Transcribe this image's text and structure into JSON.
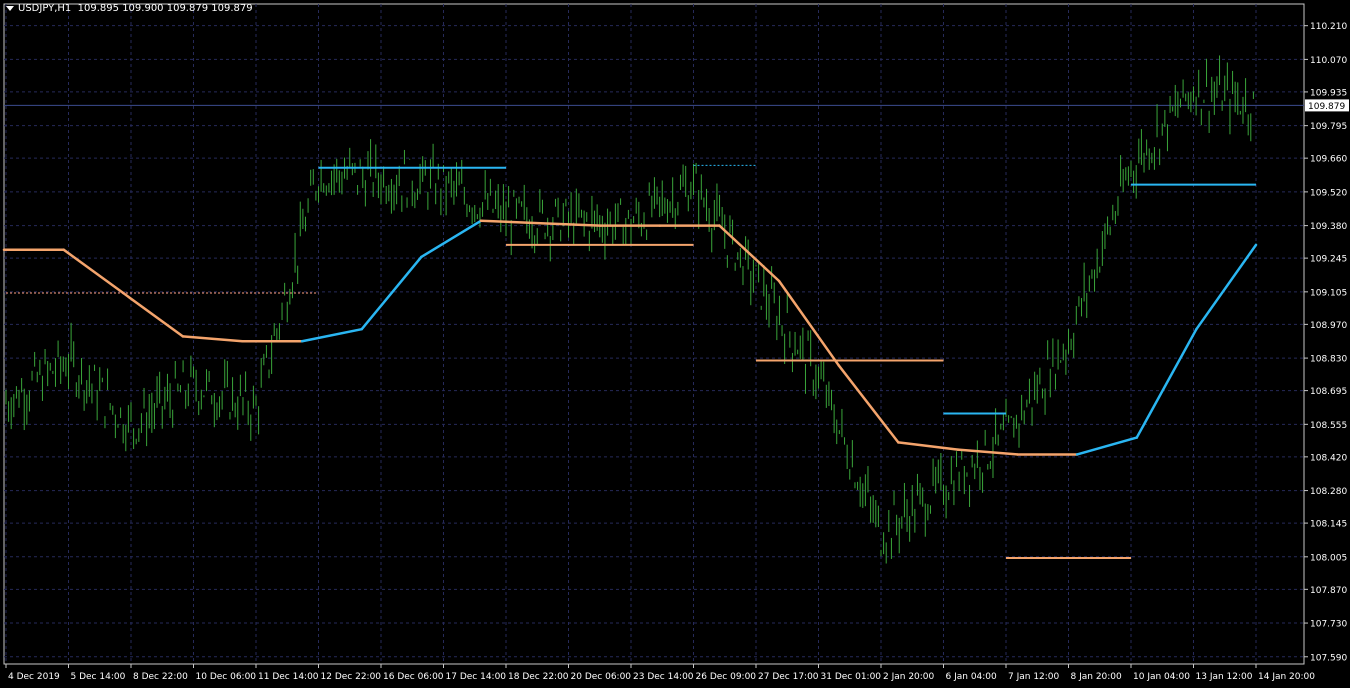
{
  "header": {
    "symbol_timeframe": "USDJPY,H1",
    "ohlc": "109.895 109.900 109.879 109.879"
  },
  "colors": {
    "background": "#000000",
    "grid": "#262a5a",
    "axis": "#c8c8c8",
    "candles": "#3aa53a",
    "ma_rising": "#2ab6f2",
    "ma_falling": "#f4a46c",
    "level_blue": "#2ab6f2",
    "level_orange": "#f4a46c",
    "dotted_orange": "#ff9f7f",
    "current_price_line": "#3b4b8f",
    "text": "#ffffff"
  },
  "chart_data": {
    "type": "line",
    "title": "USDJPY,H1",
    "instrument": "USDJPY",
    "timeframe": "H1",
    "ylim": [
      107.56,
      110.3
    ],
    "current_price": 109.879,
    "y_ticks": [
      "110.210",
      "110.070",
      "109.935",
      "109.795",
      "109.660",
      "109.520",
      "109.380",
      "109.245",
      "109.105",
      "108.970",
      "108.830",
      "108.695",
      "108.555",
      "108.420",
      "108.280",
      "108.145",
      "108.005",
      "107.870",
      "107.730",
      "107.590"
    ],
    "x_ticks": [
      "4 Dec 2019",
      "5 Dec 14:00",
      "8 Dec 22:00",
      "10 Dec 06:00",
      "11 Dec 14:00",
      "12 Dec 22:00",
      "16 Dec 06:00",
      "17 Dec 14:00",
      "18 Dec 22:00",
      "20 Dec 06:00",
      "23 Dec 14:00",
      "26 Dec 09:00",
      "27 Dec 17:00",
      "31 Dec 01:00",
      "2 Jan 20:00",
      "6 Jan 04:00",
      "7 Jan 12:00",
      "8 Jan 20:00",
      "10 Jan 04:00",
      "13 Jan 12:00",
      "14 Jan 20:00"
    ],
    "grid": true,
    "price_series": {
      "name": "USDJPY",
      "x": [
        "4 Dec 2019",
        "5 Dec 14:00",
        "8 Dec 22:00",
        "10 Dec 06:00",
        "11 Dec 14:00",
        "12 Dec 22:00",
        "16 Dec 06:00",
        "17 Dec 14:00",
        "18 Dec 22:00",
        "20 Dec 06:00",
        "23 Dec 14:00",
        "26 Dec 09:00",
        "27 Dec 17:00",
        "31 Dec 01:00",
        "2 Jan 20:00",
        "6 Jan 04:00",
        "7 Jan 12:00",
        "8 Jan 20:00",
        "10 Jan 04:00",
        "13 Jan 12:00",
        "14 Jan 20:00"
      ],
      "values": [
        108.65,
        108.82,
        108.55,
        108.72,
        108.62,
        109.6,
        109.58,
        109.55,
        109.42,
        109.4,
        109.39,
        109.55,
        109.15,
        108.75,
        108.1,
        108.3,
        108.5,
        108.9,
        109.62,
        109.95,
        109.88
      ]
    },
    "moving_average": {
      "x_range": [
        "4 Dec 2019",
        "14 Jan 20:00"
      ],
      "values": [
        109.28,
        109.28,
        109.1,
        108.92,
        108.9,
        108.9,
        108.95,
        109.25,
        109.4,
        109.39,
        109.38,
        109.38,
        109.38,
        109.15,
        108.8,
        108.48,
        108.45,
        108.43,
        108.43,
        108.5,
        108.95,
        109.3
      ]
    },
    "levels": [
      {
        "price": 109.62,
        "from": "12 Dec 22:00",
        "to": "18 Dec 22:00",
        "style": "solid",
        "color": "blue"
      },
      {
        "price": 109.1,
        "from": "4 Dec 2019",
        "to": "12 Dec 22:00",
        "style": "dotted",
        "color": "orange"
      },
      {
        "price": 109.3,
        "from": "18 Dec 22:00",
        "to": "26 Dec 09:00",
        "style": "solid",
        "color": "orange"
      },
      {
        "price": 109.63,
        "from": "26 Dec 09:00",
        "to": "27 Dec 17:00",
        "style": "dotted",
        "color": "blue"
      },
      {
        "price": 108.82,
        "from": "27 Dec 17:00",
        "to": "6 Jan 04:00",
        "style": "solid",
        "color": "orange"
      },
      {
        "price": 108.6,
        "from": "6 Jan 04:00",
        "to": "7 Jan 12:00",
        "style": "solid",
        "color": "blue"
      },
      {
        "price": 108.0,
        "from": "7 Jan 12:00",
        "to": "10 Jan 04:00",
        "style": "solid",
        "color": "orange"
      },
      {
        "price": 109.55,
        "from": "10 Jan 04:00",
        "to": "14 Jan 20:00",
        "style": "solid",
        "color": "blue"
      }
    ]
  }
}
